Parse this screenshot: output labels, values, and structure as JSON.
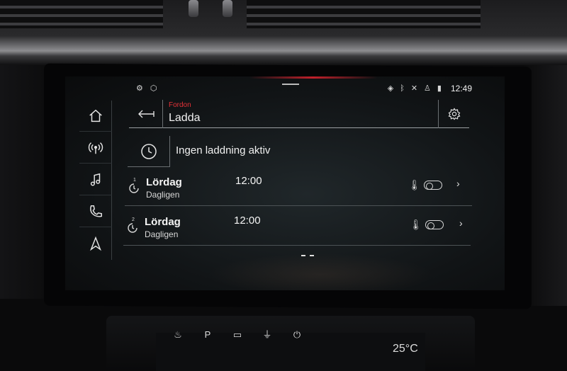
{
  "status_bar": {
    "left_icons": [
      "car-settings-icon",
      "package-icon"
    ],
    "right_icons": [
      "location-icon",
      "bluetooth-icon",
      "mute-icon",
      "person-icon",
      "lte-signal-icon"
    ],
    "clock": "12:49"
  },
  "rail": {
    "items": [
      {
        "name": "home-icon"
      },
      {
        "name": "radio-icon"
      },
      {
        "name": "music-icon"
      },
      {
        "name": "phone-icon"
      },
      {
        "name": "navigation-icon"
      }
    ]
  },
  "header": {
    "breadcrumb": "Fordon",
    "title": "Ladda"
  },
  "status": {
    "text": "Ingen laddning aktiv"
  },
  "timers": [
    {
      "number": "1",
      "day": "Lördag",
      "frequency": "Dagligen",
      "time": "12:00",
      "enabled": false
    },
    {
      "number": "2",
      "day": "Lördag",
      "frequency": "Dagligen",
      "time": "12:00",
      "enabled": false
    }
  ],
  "lower_panel": {
    "temperature": "25°C"
  },
  "colors": {
    "accent": "#e53238",
    "text": "#f0f0f0"
  }
}
